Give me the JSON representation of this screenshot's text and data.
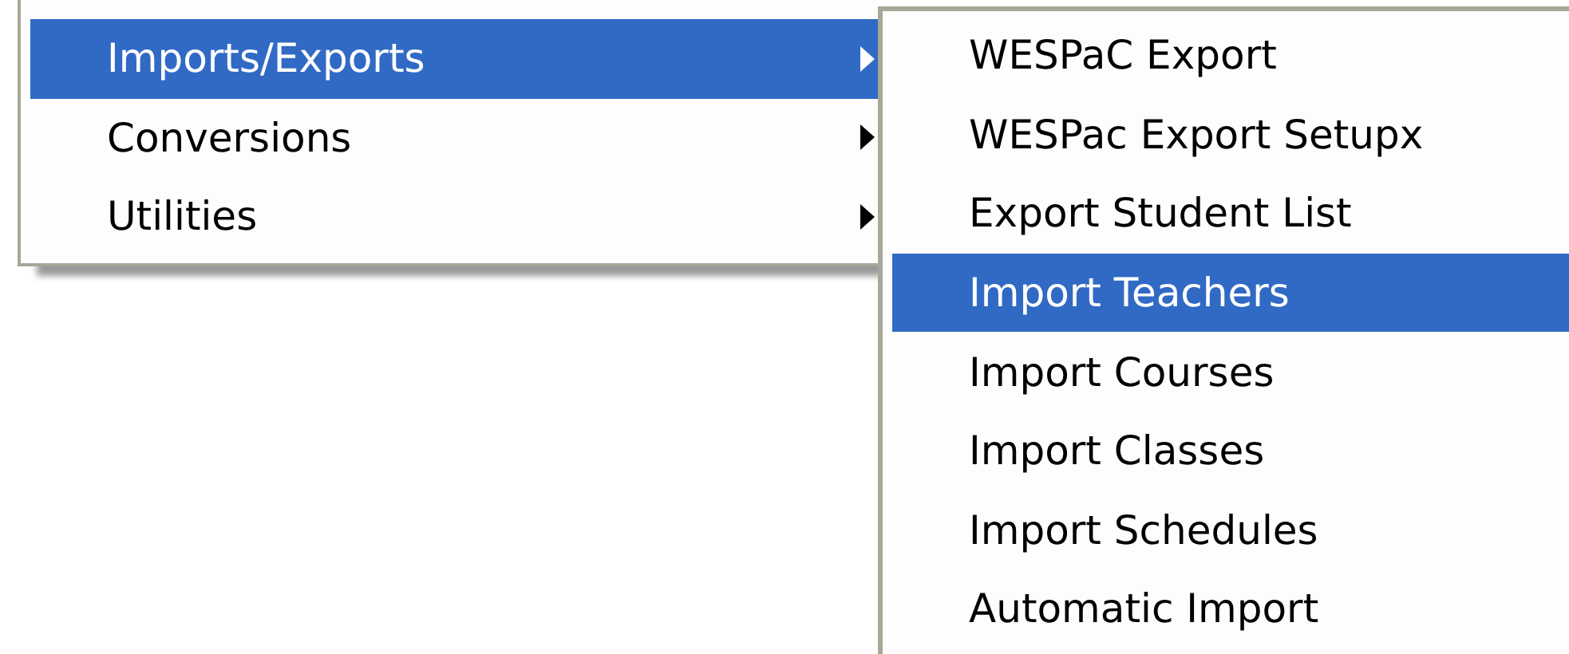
{
  "menu": {
    "items": [
      {
        "label": "Imports/Exports",
        "selected": true,
        "has_submenu": true
      },
      {
        "label": "Conversions",
        "selected": false,
        "has_submenu": true
      },
      {
        "label": "Utilities",
        "selected": false,
        "has_submenu": true
      }
    ]
  },
  "submenu": {
    "items": [
      {
        "label": "WESPaC Export",
        "selected": false
      },
      {
        "label": "WESPac Export Setupx",
        "selected": false
      },
      {
        "label": "Export Student List",
        "selected": false
      },
      {
        "label": "Import Teachers",
        "selected": true
      },
      {
        "label": "Import Courses",
        "selected": false
      },
      {
        "label": "Import Classes",
        "selected": false
      },
      {
        "label": "Import Schedules",
        "selected": false
      },
      {
        "label": "Automatic Import",
        "selected": false
      }
    ]
  }
}
